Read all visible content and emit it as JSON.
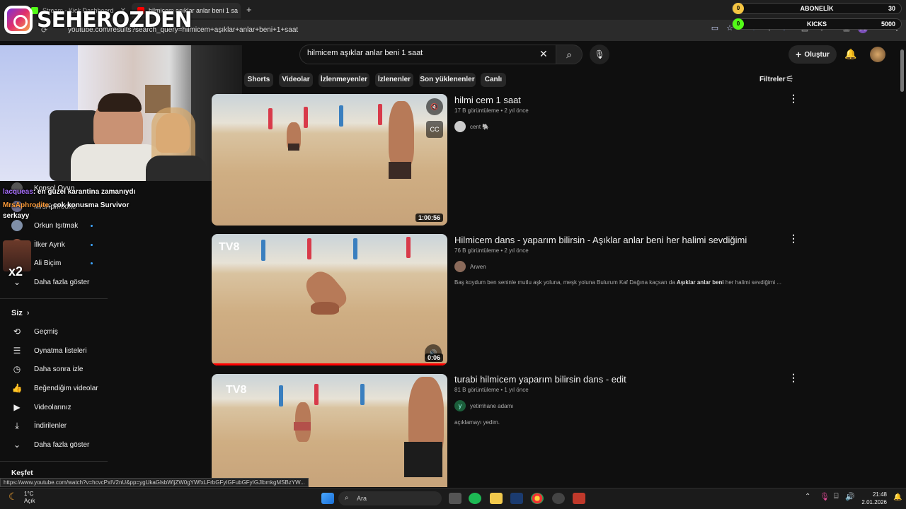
{
  "browser": {
    "tabs": [
      {
        "title": "Stream - Kick Dashboard",
        "favicon_color": "#53fc18"
      },
      {
        "title": "hilmicem aşıklar anlar beni 1 sa",
        "favicon_color": "#ff0000"
      }
    ],
    "new_tab": "+",
    "url": "youtube.com/results?search_query=hilmicem+aşıklar+anlar+beni+1+saat"
  },
  "overlay": {
    "brand_name": "SEHEROZDEN",
    "stats": [
      {
        "badge": "0",
        "label": "ABONELİK",
        "value": "30",
        "badge_color": "#f5c542"
      },
      {
        "badge": "0",
        "label": "KICKS",
        "value": "5000",
        "badge_color": "#53fc18"
      }
    ]
  },
  "youtube": {
    "search_query": "hilmicem aşıklar anlar beni 1 saat",
    "create_label": "Oluştur",
    "filters_label": "Filtreler",
    "chips": [
      "Shorts",
      "Videolar",
      "İzlenmeyenler",
      "İzlenenler",
      "Son yüklenenler",
      "Canlı"
    ]
  },
  "chat": [
    {
      "user": "lacqueas",
      "message": ": en güzel karantina zamanıydı",
      "color": "#a970ff"
    },
    {
      "user": "MrsAphrodite",
      "message": ": çok konusma Survivor",
      "color": "#ff9d3b"
    },
    {
      "user": "serkayy",
      "message": "",
      "color": "#ffffff"
    }
  ],
  "sidebar": {
    "subscriptions": [
      {
        "label": "Konsol Oyun",
        "avatar_color": "#555"
      },
      {
        "label": "MrsAphrodite",
        "avatar_color": "#6a6a8a"
      },
      {
        "label": "Orkun Işıtmak",
        "avatar_color": "#7f8fa8"
      },
      {
        "label": "İlker Ayrık",
        "avatar_color": "#8a4e3a"
      },
      {
        "label": "Ali Biçim",
        "avatar_color": "#777"
      }
    ],
    "more_label": "Daha fazla göster",
    "you_section": "Siz",
    "you_items": [
      {
        "label": "Geçmiş",
        "icon": "history-icon"
      },
      {
        "label": "Oynatma listeleri",
        "icon": "playlist-icon"
      },
      {
        "label": "Daha sonra izle",
        "icon": "watch-later-icon"
      },
      {
        "label": "Beğendiğim videolar",
        "icon": "like-icon"
      },
      {
        "label": "Videolarınız",
        "icon": "your-videos-icon"
      },
      {
        "label": "İndirilenler",
        "icon": "download-icon"
      },
      {
        "label": "Daha fazla göster",
        "icon": "chevron-down-icon"
      }
    ],
    "explore_section": "Keşfet",
    "x2_badge": "x2"
  },
  "results": [
    {
      "title": "hilmi cem 1 saat",
      "views": "17 B görüntüleme",
      "age": "2 yıl önce",
      "channel": "cent 🐘",
      "channel_color": "#cccccc",
      "description": "",
      "duration": "1:00:56"
    },
    {
      "title": "Hilmicem dans - yaparım bilirsin - Aşıklar anlar beni her halimi sevdiğimi",
      "views": "76 B görüntüleme",
      "age": "2 yıl önce",
      "channel": "Arwen",
      "channel_color": "#8a6a5a",
      "description_pre": "Baş koydum ben seninle mutlu aşk yoluna, meşk yoluna Bulurum Kaf Dağına kaçsan da ",
      "description_bold": "Aşıklar anlar beni",
      "description_post": " her halimi sevdiğimi ...",
      "duration": "0:06"
    },
    {
      "title": "turabi hilmicem yaparım bilirsin dans - edit",
      "views": "81 B görüntüleme",
      "age": "1 yıl önce",
      "channel": "yetimhane adamı",
      "channel_color": "#1b5e3a",
      "channel_initial": "y",
      "description": "açıklamayı yedim.",
      "duration": ""
    }
  ],
  "status_url": "https://www.youtube.com/watch?v=hcvcPxIV2nU&pp=ygUkaGlsbWljZW0gYWfxLFrbGFyIGFubGFyIGJlbmkgMSBzYW...",
  "taskbar": {
    "temperature": "1°C",
    "weather": "Açık",
    "search_label": "Ara",
    "time": "21:48",
    "date": "2.01.2026"
  }
}
